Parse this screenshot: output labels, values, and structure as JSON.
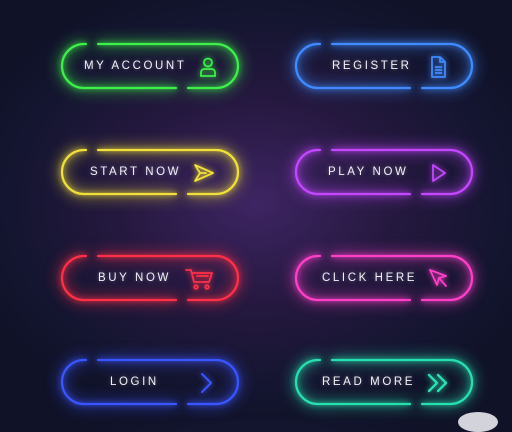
{
  "buttons": [
    {
      "id": "my-account",
      "label": "MY ACCOUNT",
      "color": "#3df04a",
      "icon": "user-icon"
    },
    {
      "id": "register",
      "label": "REGISTER",
      "color": "#3f8bff",
      "icon": "document-icon"
    },
    {
      "id": "start-now",
      "label": "START NOW",
      "color": "#f2e03a",
      "icon": "send-arrow-icon"
    },
    {
      "id": "play-now",
      "label": "PLAY NOW",
      "color": "#c446ff",
      "icon": "play-icon"
    },
    {
      "id": "buy-now",
      "label": "BUY NOW",
      "color": "#ff2f47",
      "icon": "shopping-cart-icon"
    },
    {
      "id": "click-here",
      "label": "CLICK HERE",
      "color": "#ff3fc8",
      "icon": "cursor-icon"
    },
    {
      "id": "login",
      "label": "LOGIN",
      "color": "#3a55ff",
      "icon": "chevron-right-icon"
    },
    {
      "id": "read-more",
      "label": "READ MORE",
      "color": "#27e0b0",
      "icon": "double-chevron-right-icon"
    }
  ]
}
